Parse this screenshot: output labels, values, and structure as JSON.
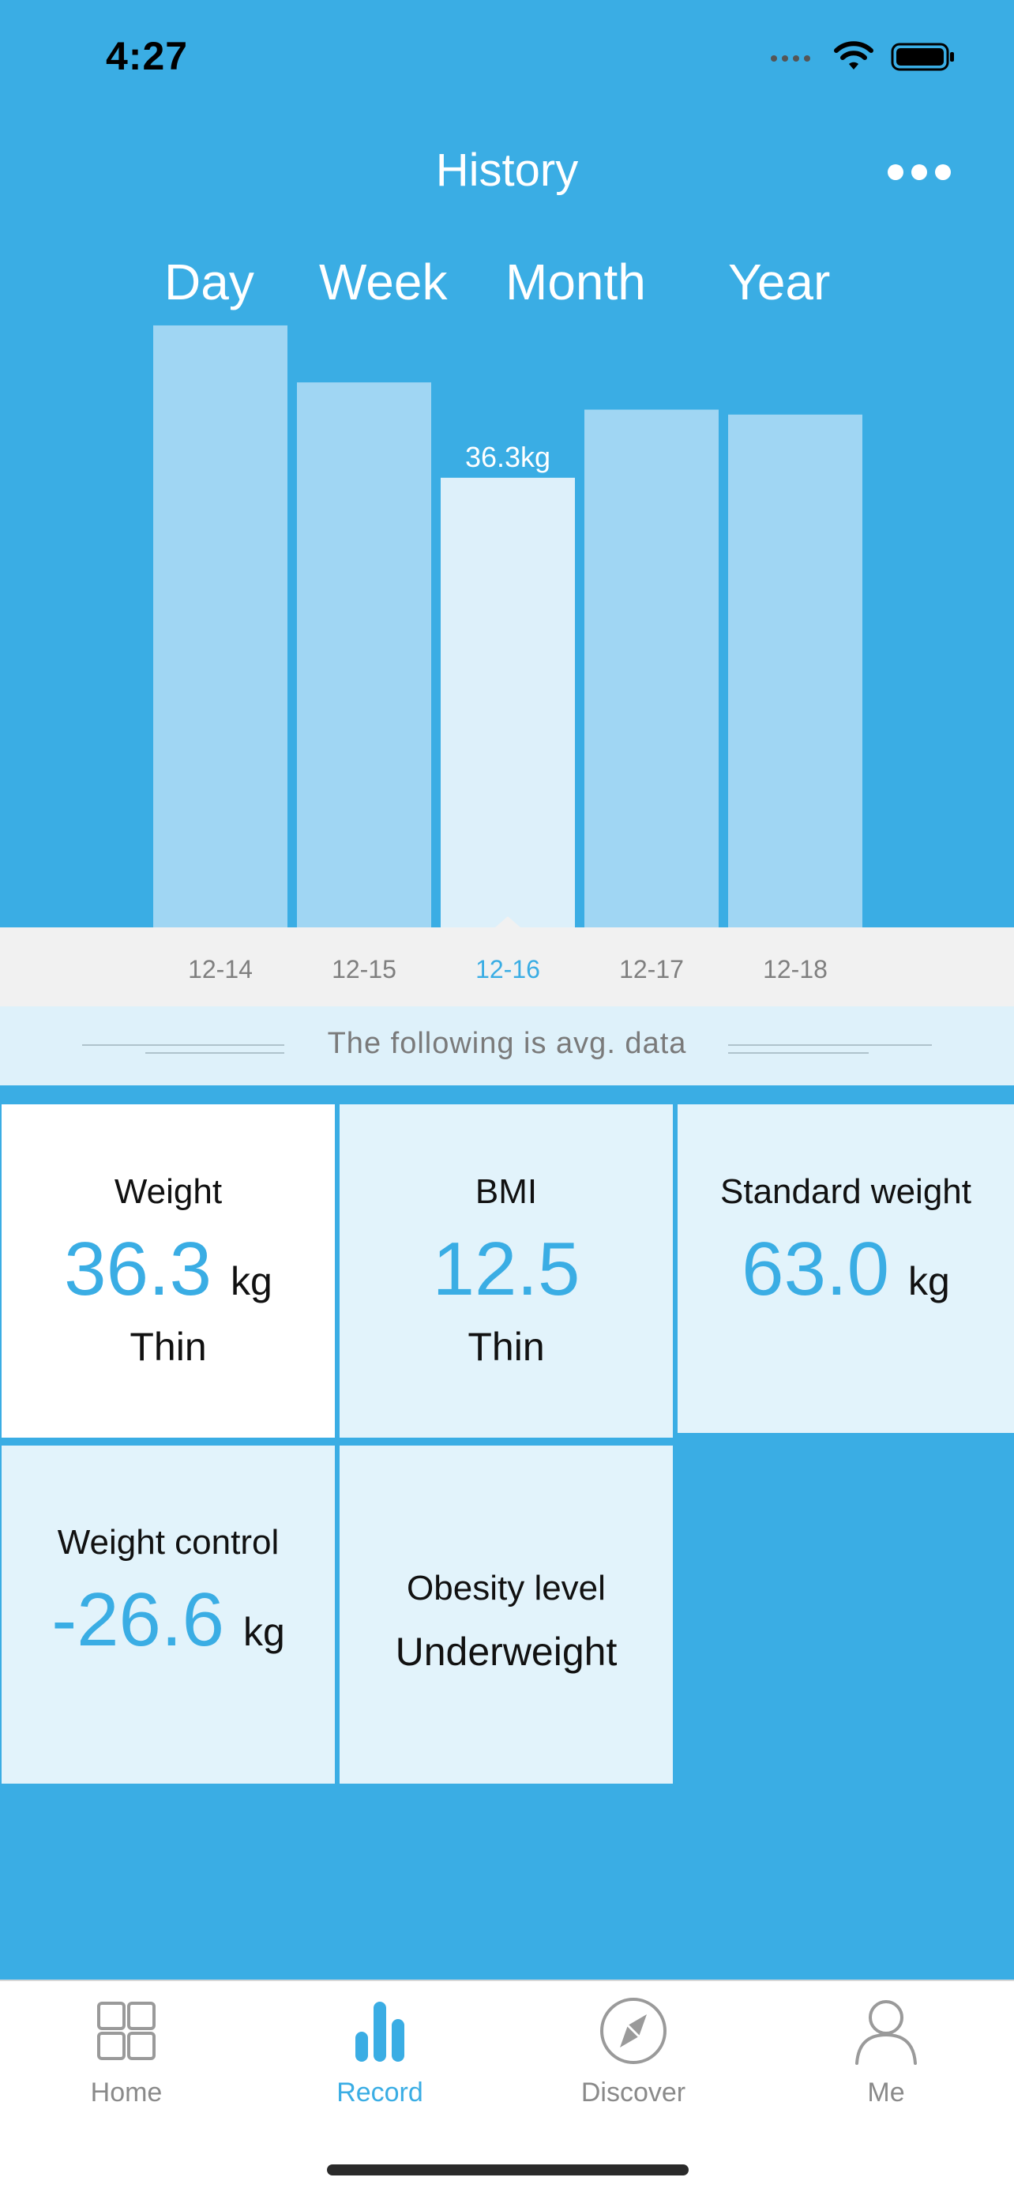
{
  "status_bar": {
    "time": "4:27"
  },
  "header": {
    "title": "History",
    "more_icon": "ellipsis-icon"
  },
  "period_tabs": [
    {
      "label": "Day",
      "selected": true
    },
    {
      "label": "Week",
      "selected": false
    },
    {
      "label": "Month",
      "selected": false
    },
    {
      "label": "Year",
      "selected": false
    }
  ],
  "chart_data": {
    "type": "bar",
    "categories": [
      "12-14",
      "12-15",
      "12-16",
      "12-17",
      "12-18"
    ],
    "values": [
      48.6,
      44.0,
      36.3,
      41.8,
      41.4
    ],
    "selected_index": 2,
    "selected_label": "36.3kg",
    "unit": "kg",
    "ylim": [
      0,
      50
    ],
    "bar_color": "#A0D6F3",
    "selected_bar_color": "#DDF0FA",
    "selected_label_color": "#3AADE4"
  },
  "avg_banner": {
    "text": "The following is avg. data"
  },
  "stats": {
    "weight": {
      "label": "Weight",
      "value": "36.3",
      "unit": "kg",
      "status": "Thin"
    },
    "bmi": {
      "label": "BMI",
      "value": "12.5",
      "status": "Thin"
    },
    "standard_weight": {
      "label": "Standard weight",
      "value": "63.0",
      "unit": "kg"
    },
    "weight_control": {
      "label": "Weight control",
      "value": "-26.6",
      "unit": "kg"
    },
    "obesity_level": {
      "label": "Obesity level",
      "value": "Underweight"
    }
  },
  "tab_bar": [
    {
      "label": "Home",
      "icon": "home-grid-icon",
      "selected": false
    },
    {
      "label": "Record",
      "icon": "bar-chart-icon",
      "selected": true
    },
    {
      "label": "Discover",
      "icon": "compass-icon",
      "selected": false
    },
    {
      "label": "Me",
      "icon": "person-icon",
      "selected": false
    }
  ],
  "colors": {
    "background": "#3AADE4",
    "accent": "#3AADE4",
    "card": "#E2F3FB",
    "axis_strip": "#F1F1F1"
  }
}
